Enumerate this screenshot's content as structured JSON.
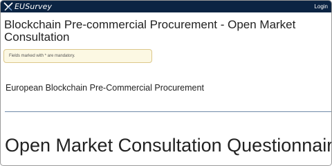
{
  "header": {
    "logo_text": "EUSurvey",
    "login_label": "Login",
    "logo_icon": "eusurvey-logo-icon"
  },
  "survey": {
    "title": "Blockchain Pre-commercial Procurement - Open Market Consultation",
    "mandatory_notice": "Fields marked with * are mandatory.",
    "section_title": "European Blockchain Pre-Commercial Procurement",
    "heading": "Open Market Consultation Questionnaire"
  },
  "colors": {
    "topbar": "#0b2443",
    "notice_bg": "#fcf8e3",
    "notice_border": "#dcc78a",
    "divider": "#6f8aa8"
  }
}
